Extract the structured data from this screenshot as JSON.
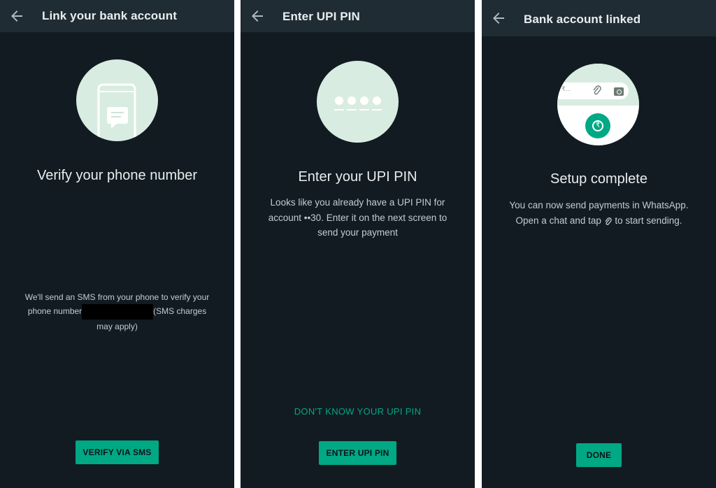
{
  "screens": [
    {
      "title": "Link your bank account",
      "heading": "Verify your phone number",
      "body_part1": "We'll send an SMS from your phone to verify your phone number",
      "body_part2": "(SMS charges may apply)",
      "button": "VERIFY VIA SMS"
    },
    {
      "title": "Enter UPI PIN",
      "heading": "Enter your UPI PIN",
      "body": "Looks like you already have a UPI PIN for account ••30. Enter it on the next screen to send your payment",
      "link": "DON'T KNOW YOUR UPI PIN",
      "button": "ENTER UPI PIN"
    },
    {
      "title": "Bank account linked",
      "heading": "Setup complete",
      "body_line1": "You can now send payments in WhatsApp.",
      "body_line2_before": "Open a chat and tap",
      "body_line2_after": "to start sending.",
      "button": "DONE",
      "illustration_field_text": "₹..."
    }
  ],
  "colors": {
    "background": "#121b22",
    "appbar": "#1f2c34",
    "accent": "#00a884",
    "illustration": "#d9ece1"
  },
  "icons": [
    "back-arrow-icon",
    "phone-message-icon",
    "pin-dots-icon",
    "attach-paperclip-icon",
    "camera-icon",
    "rupee-icon"
  ]
}
